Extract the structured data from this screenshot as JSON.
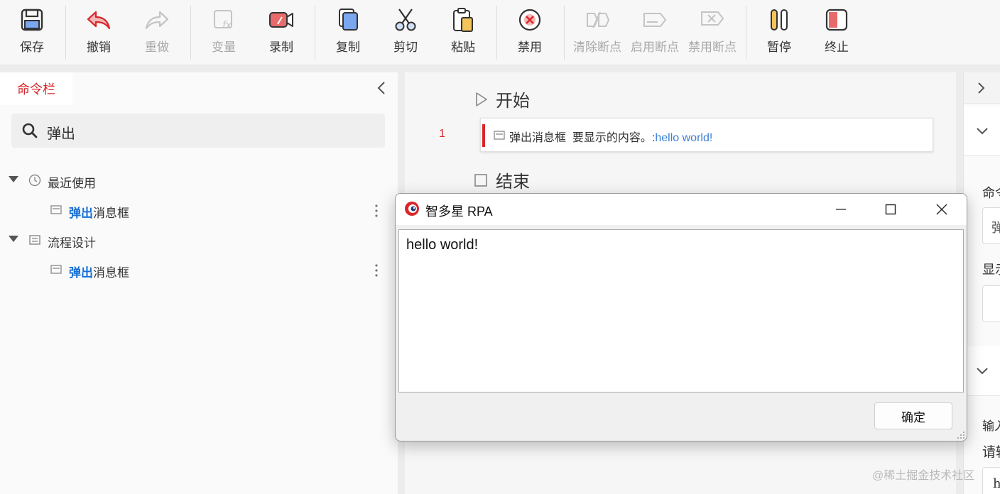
{
  "toolbar": {
    "save": "保存",
    "undo": "撤销",
    "redo": "重做",
    "variable": "变量",
    "record": "录制",
    "copy": "复制",
    "cut": "剪切",
    "paste": "粘贴",
    "disable": "禁用",
    "clear_breakpoints": "清除断点",
    "enable_breakpoints": "启用断点",
    "disable_breakpoints": "禁用断点",
    "pause": "暂停",
    "stop": "终止"
  },
  "left_panel": {
    "tab_label": "命令栏",
    "search_value": "弹出",
    "groups": [
      {
        "label": "最近使用",
        "icon": "clock-icon",
        "item_highlight": "弹出",
        "item_rest": "消息框"
      },
      {
        "label": "流程设计",
        "icon": "flow-icon",
        "item_highlight": "弹出",
        "item_rest": "消息框"
      }
    ]
  },
  "flow": {
    "start_label": "开始",
    "end_label": "结束",
    "line_number": "1",
    "command_name": "弹出消息框",
    "param_label": "要显示的内容。:",
    "param_value": "hello world!"
  },
  "right_panel": {
    "label_1": "命令",
    "input_1": "弹",
    "label_2": "显示",
    "label_3": "输入",
    "label_4": "请输",
    "input_2": "h"
  },
  "dialog": {
    "title": "智多星 RPA",
    "message": "hello world!",
    "ok_label": "确定"
  },
  "watermark": "@稀土掘金技术社区",
  "colors": {
    "accent_red": "#d8262a",
    "link_blue": "#3a7fd5",
    "highlight_blue": "#1670d6"
  }
}
